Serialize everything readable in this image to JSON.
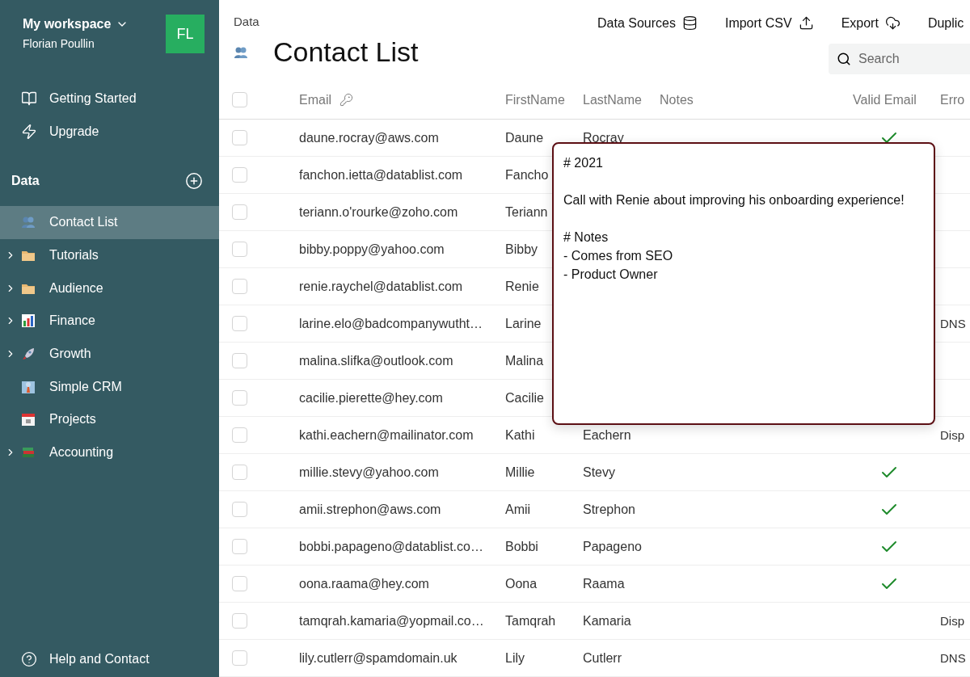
{
  "workspace": {
    "name": "My workspace",
    "user": "Florian Poullin",
    "avatar": "FL"
  },
  "nav": [
    {
      "label": "Getting Started"
    },
    {
      "label": "Upgrade"
    }
  ],
  "data_section": {
    "title": "Data"
  },
  "tree": [
    {
      "label": "Contact List",
      "selected": true,
      "has_children": false
    },
    {
      "label": "Tutorials",
      "selected": false,
      "has_children": true
    },
    {
      "label": "Audience",
      "selected": false,
      "has_children": true
    },
    {
      "label": "Finance",
      "selected": false,
      "has_children": true
    },
    {
      "label": "Growth",
      "selected": false,
      "has_children": true
    },
    {
      "label": "Simple CRM",
      "selected": false,
      "has_children": false
    },
    {
      "label": "Projects",
      "selected": false,
      "has_children": false
    },
    {
      "label": "Accounting",
      "selected": false,
      "has_children": true
    }
  ],
  "help": {
    "label": "Help and Contact"
  },
  "breadcrumb": "Data",
  "title": "Contact List",
  "actions": [
    {
      "label": "Data Sources"
    },
    {
      "label": "Import CSV"
    },
    {
      "label": "Export"
    },
    {
      "label": "Duplic"
    }
  ],
  "search": {
    "placeholder": "Search"
  },
  "table": {
    "all_selected": false,
    "columns": [
      "Email",
      "FirstName",
      "LastName",
      "Notes",
      "Valid Email",
      "Erro"
    ],
    "rows": [
      {
        "selected": false,
        "email": "daune.rocray@aws.com",
        "first": "Daune",
        "last": "Rocray",
        "valid": true
      },
      {
        "selected": false,
        "email": "fanchon.ietta@datablist.com",
        "first": "Fancho"
      },
      {
        "selected": false,
        "email": "teriann.o'rourke@zoho.com",
        "first": "Teriann"
      },
      {
        "selected": false,
        "email": "bibby.poppy@yahoo.com",
        "first": "Bibby"
      },
      {
        "selected": false,
        "email": "renie.raychel@datablist.com",
        "first": "Renie"
      },
      {
        "selected": false,
        "email": "larine.elo@badcompanywutht…",
        "first": "Larine",
        "error": "DNS"
      },
      {
        "selected": false,
        "email": "malina.slifka@outlook.com",
        "first": "Malina"
      },
      {
        "selected": false,
        "email": "cacilie.pierette@hey.com",
        "first": "Cacilie"
      },
      {
        "selected": false,
        "email": "kathi.eachern@mailinator.com",
        "first": "Kathi",
        "last": "Eachern",
        "valid": false,
        "error": "Disp"
      },
      {
        "selected": false,
        "email": "millie.stevy@yahoo.com",
        "first": "Millie",
        "last": "Stevy",
        "valid": true
      },
      {
        "selected": false,
        "email": "amii.strephon@aws.com",
        "first": "Amii",
        "last": "Strephon",
        "valid": true
      },
      {
        "selected": false,
        "email": "bobbi.papageno@datablist.co…",
        "first": "Bobbi",
        "last": "Papageno",
        "valid": true
      },
      {
        "selected": false,
        "email": "oona.raama@hey.com",
        "first": "Oona",
        "last": "Raama",
        "valid": true
      },
      {
        "selected": false,
        "email": "tamqrah.kamaria@yopmail.co…",
        "first": "Tamqrah",
        "last": "Kamaria",
        "valid": false,
        "error": "Disp"
      },
      {
        "selected": false,
        "email": "lily.cutlerr@spamdomain.uk",
        "first": "Lily",
        "last": "Cutlerr",
        "valid": false,
        "error": "DNS"
      }
    ]
  },
  "notes_popup": {
    "text": "# 2021\n\nCall with Renie about improving his onboarding experience!\n\n# Notes\n- Comes from SEO\n- Product Owner"
  }
}
